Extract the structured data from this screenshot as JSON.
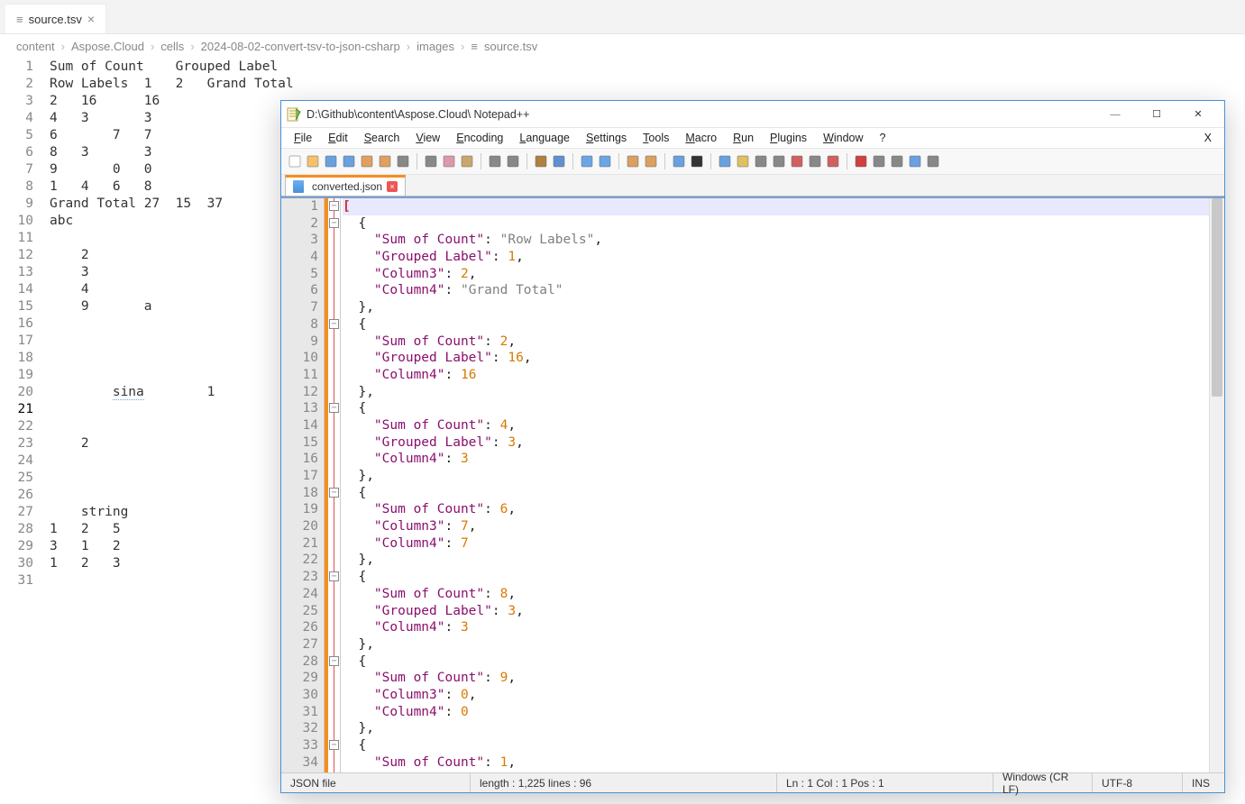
{
  "vscode": {
    "tab": "source.tsv",
    "breadcrumb": [
      "content",
      "Aspose.Cloud",
      "cells",
      "2024-08-02-convert-tsv-to-json-csharp",
      "images",
      "source.tsv"
    ],
    "lines": [
      "Sum of Count    Grouped Label",
      "Row Labels  1   2   Grand Total",
      "2   16      16",
      "4   3       3",
      "6       7   7",
      "8   3       3",
      "9       0   0",
      "1   4   6   8",
      "Grand Total 27  15  37",
      "abc",
      "",
      "    2",
      "    3",
      "    4",
      "    9       a",
      "",
      "",
      "",
      "",
      "        sina        1",
      "",
      "",
      "    2",
      "",
      "",
      "",
      "    string",
      "1   2   5",
      "3   1   2",
      "1   2   3",
      ""
    ]
  },
  "npp": {
    "title": "D:\\Github\\content\\Aspose.Cloud\\ Notepad++",
    "menus": [
      "File",
      "Edit",
      "Search",
      "View",
      "Encoding",
      "Language",
      "Settings",
      "Tools",
      "Macro",
      "Run",
      "Plugins",
      "Window",
      "?"
    ],
    "tab": "converted.json",
    "json_lines": [
      {
        "n": 1,
        "t": "[",
        "fold": "box",
        "cls": "cur br"
      },
      {
        "n": 2,
        "t": "  {",
        "fold": "box"
      },
      {
        "n": 3,
        "t": "    \"Sum of Count\": \"Row Labels\",",
        "seg": [
          [
            "    ",
            ""
          ],
          [
            "\"Sum of Count\"",
            "k"
          ],
          [
            ": ",
            ""
          ],
          [
            "\"Row Labels\"",
            "s"
          ],
          [
            ",",
            ""
          ]
        ]
      },
      {
        "n": 4,
        "t": "    \"Grouped Label\": 1,",
        "seg": [
          [
            "    ",
            ""
          ],
          [
            "\"Grouped Label\"",
            "k"
          ],
          [
            ": ",
            ""
          ],
          [
            "1",
            "n"
          ],
          [
            ",",
            ""
          ]
        ]
      },
      {
        "n": 5,
        "t": "    \"Column3\": 2,",
        "seg": [
          [
            "    ",
            ""
          ],
          [
            "\"Column3\"",
            "k"
          ],
          [
            ": ",
            ""
          ],
          [
            "2",
            "n"
          ],
          [
            ",",
            ""
          ]
        ]
      },
      {
        "n": 6,
        "t": "    \"Column4\": \"Grand Total\"",
        "seg": [
          [
            "    ",
            ""
          ],
          [
            "\"Column4\"",
            "k"
          ],
          [
            ": ",
            ""
          ],
          [
            "\"Grand Total\"",
            "s"
          ]
        ]
      },
      {
        "n": 7,
        "t": "  },"
      },
      {
        "n": 8,
        "t": "  {",
        "fold": "box"
      },
      {
        "n": 9,
        "t": "    \"Sum of Count\": 2,",
        "seg": [
          [
            "    ",
            ""
          ],
          [
            "\"Sum of Count\"",
            "k"
          ],
          [
            ": ",
            ""
          ],
          [
            "2",
            "n"
          ],
          [
            ",",
            ""
          ]
        ]
      },
      {
        "n": 10,
        "t": "    \"Grouped Label\": 16,",
        "seg": [
          [
            "    ",
            ""
          ],
          [
            "\"Grouped Label\"",
            "k"
          ],
          [
            ": ",
            ""
          ],
          [
            "16",
            "n"
          ],
          [
            ",",
            ""
          ]
        ]
      },
      {
        "n": 11,
        "t": "    \"Column4\": 16",
        "seg": [
          [
            "    ",
            ""
          ],
          [
            "\"Column4\"",
            "k"
          ],
          [
            ": ",
            ""
          ],
          [
            "16",
            "n"
          ]
        ]
      },
      {
        "n": 12,
        "t": "  },"
      },
      {
        "n": 13,
        "t": "  {",
        "fold": "box"
      },
      {
        "n": 14,
        "t": "    \"Sum of Count\": 4,",
        "seg": [
          [
            "    ",
            ""
          ],
          [
            "\"Sum of Count\"",
            "k"
          ],
          [
            ": ",
            ""
          ],
          [
            "4",
            "n"
          ],
          [
            ",",
            ""
          ]
        ]
      },
      {
        "n": 15,
        "t": "    \"Grouped Label\": 3,",
        "seg": [
          [
            "    ",
            ""
          ],
          [
            "\"Grouped Label\"",
            "k"
          ],
          [
            ": ",
            ""
          ],
          [
            "3",
            "n"
          ],
          [
            ",",
            ""
          ]
        ]
      },
      {
        "n": 16,
        "t": "    \"Column4\": 3",
        "seg": [
          [
            "    ",
            ""
          ],
          [
            "\"Column4\"",
            "k"
          ],
          [
            ": ",
            ""
          ],
          [
            "3",
            "n"
          ]
        ]
      },
      {
        "n": 17,
        "t": "  },"
      },
      {
        "n": 18,
        "t": "  {",
        "fold": "box"
      },
      {
        "n": 19,
        "t": "    \"Sum of Count\": 6,",
        "seg": [
          [
            "    ",
            ""
          ],
          [
            "\"Sum of Count\"",
            "k"
          ],
          [
            ": ",
            ""
          ],
          [
            "6",
            "n"
          ],
          [
            ",",
            ""
          ]
        ]
      },
      {
        "n": 20,
        "t": "    \"Column3\": 7,",
        "seg": [
          [
            "    ",
            ""
          ],
          [
            "\"Column3\"",
            "k"
          ],
          [
            ": ",
            ""
          ],
          [
            "7",
            "n"
          ],
          [
            ",",
            ""
          ]
        ]
      },
      {
        "n": 21,
        "t": "    \"Column4\": 7",
        "seg": [
          [
            "    ",
            ""
          ],
          [
            "\"Column4\"",
            "k"
          ],
          [
            ": ",
            ""
          ],
          [
            "7",
            "n"
          ]
        ]
      },
      {
        "n": 22,
        "t": "  },"
      },
      {
        "n": 23,
        "t": "  {",
        "fold": "box"
      },
      {
        "n": 24,
        "t": "    \"Sum of Count\": 8,",
        "seg": [
          [
            "    ",
            ""
          ],
          [
            "\"Sum of Count\"",
            "k"
          ],
          [
            ": ",
            ""
          ],
          [
            "8",
            "n"
          ],
          [
            ",",
            ""
          ]
        ]
      },
      {
        "n": 25,
        "t": "    \"Grouped Label\": 3,",
        "seg": [
          [
            "    ",
            ""
          ],
          [
            "\"Grouped Label\"",
            "k"
          ],
          [
            ": ",
            ""
          ],
          [
            "3",
            "n"
          ],
          [
            ",",
            ""
          ]
        ]
      },
      {
        "n": 26,
        "t": "    \"Column4\": 3",
        "seg": [
          [
            "    ",
            ""
          ],
          [
            "\"Column4\"",
            "k"
          ],
          [
            ": ",
            ""
          ],
          [
            "3",
            "n"
          ]
        ]
      },
      {
        "n": 27,
        "t": "  },"
      },
      {
        "n": 28,
        "t": "  {",
        "fold": "box"
      },
      {
        "n": 29,
        "t": "    \"Sum of Count\": 9,",
        "seg": [
          [
            "    ",
            ""
          ],
          [
            "\"Sum of Count\"",
            "k"
          ],
          [
            ": ",
            ""
          ],
          [
            "9",
            "n"
          ],
          [
            ",",
            ""
          ]
        ]
      },
      {
        "n": 30,
        "t": "    \"Column3\": 0,",
        "seg": [
          [
            "    ",
            ""
          ],
          [
            "\"Column3\"",
            "k"
          ],
          [
            ": ",
            ""
          ],
          [
            "0",
            "n"
          ],
          [
            ",",
            ""
          ]
        ]
      },
      {
        "n": 31,
        "t": "    \"Column4\": 0",
        "seg": [
          [
            "    ",
            ""
          ],
          [
            "\"Column4\"",
            "k"
          ],
          [
            ": ",
            ""
          ],
          [
            "0",
            "n"
          ]
        ]
      },
      {
        "n": 32,
        "t": "  },"
      },
      {
        "n": 33,
        "t": "  {",
        "fold": "box"
      },
      {
        "n": 34,
        "t": "    \"Sum of Count\": 1,",
        "seg": [
          [
            "    ",
            ""
          ],
          [
            "\"Sum of Count\"",
            "k"
          ],
          [
            ": ",
            ""
          ],
          [
            "1",
            "n"
          ],
          [
            ",",
            ""
          ]
        ]
      }
    ],
    "status": {
      "filetype": "JSON file",
      "length": "length : 1,225    lines : 96",
      "pos": "Ln : 1    Col : 1    Pos : 1",
      "eol": "Windows (CR LF)",
      "enc": "UTF-8",
      "ins": "INS"
    }
  }
}
